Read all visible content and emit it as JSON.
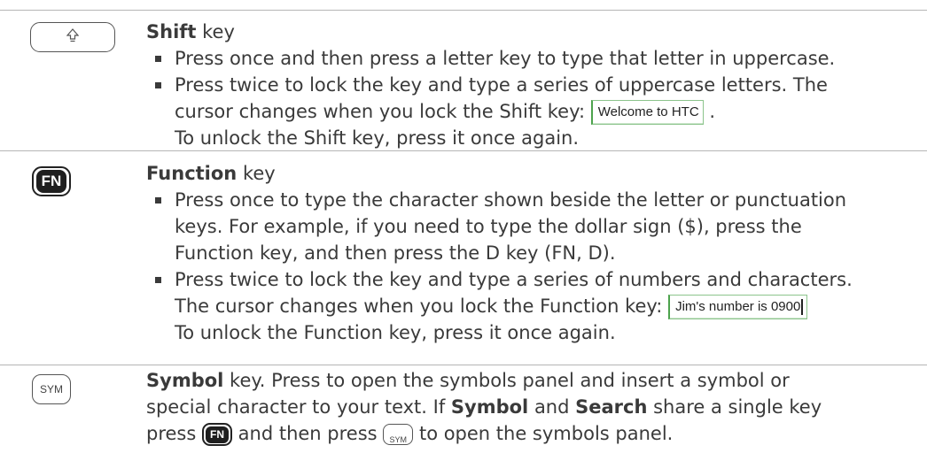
{
  "shift": {
    "key_icon": "up-arrow-outline-icon",
    "title_bold": "Shift",
    "title_rest": " key",
    "bullet1": "Press once and then press a letter key to type that letter in uppercase.",
    "bullet2_line1": "Press twice to lock the key and type a series of uppercase letters. The",
    "bullet2_line2_before": "cursor changes when you lock the Shift key: ",
    "cursor_sample": "Welcome to HTC",
    "bullet2_line2_after": " .",
    "bullet2_line3": "To unlock the Shift key, press it once again."
  },
  "fn": {
    "key_label": "FN",
    "title_bold": "Function",
    "title_rest": " key",
    "bullet1_line1": "Press once to type the character shown beside the letter or punctuation",
    "bullet1_line2": "keys. For example, if you need to type the dollar sign ($), press the",
    "bullet1_line3": "Function key, and then press the D key (FN, D).",
    "bullet2_line1": "Press twice to lock the key and type a series of numbers and characters.",
    "bullet2_line2_before": "The cursor changes when you lock the Function key: ",
    "cursor_sample": "Jim's number is 0900",
    "bullet2_line3": "To unlock the Function key, press it once again."
  },
  "sym": {
    "key_label": "SYM",
    "title_bold": "Symbol",
    "text1": " key.  Press to open the symbols panel and insert a symbol or",
    "line2": "special character to your text. If ",
    "line2_b1": "Symbol",
    "line2_mid": " and ",
    "line2_b2": "Search",
    "line2_end": " share a single key",
    "line3_start": "press ",
    "line3_mid": " and then press ",
    "line3_end": " to open the symbols panel.",
    "mini_fn_label": "FN",
    "mini_sym_label": "SYM"
  }
}
